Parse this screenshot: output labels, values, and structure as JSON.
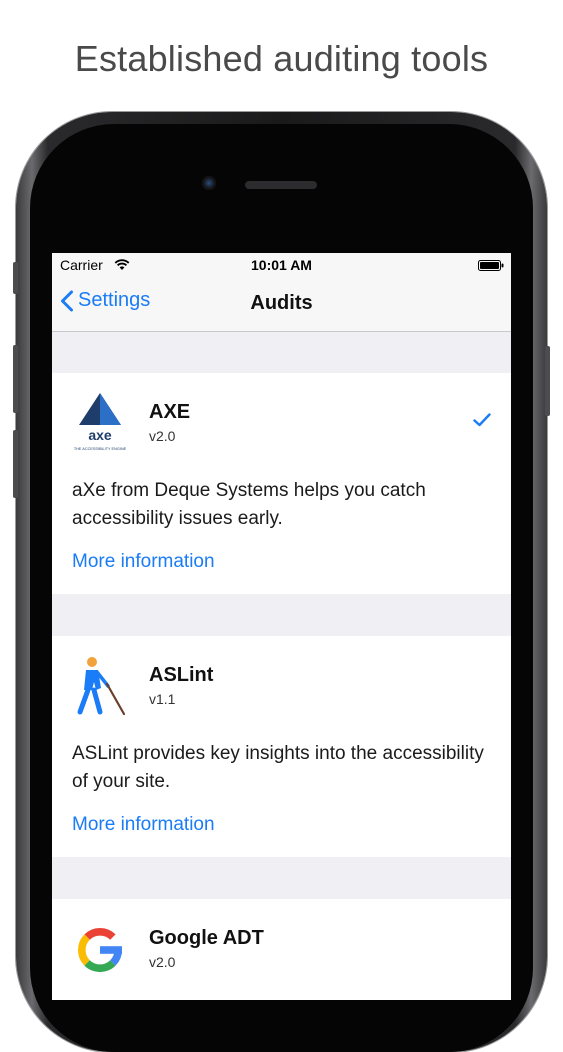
{
  "headline": "Established auditing tools",
  "status_bar": {
    "carrier": "Carrier",
    "time": "10:01 AM",
    "icons": [
      "wifi-icon",
      "battery-icon"
    ]
  },
  "nav": {
    "back_label": "Settings",
    "title": "Audits",
    "back_icon": "chevron-left-icon"
  },
  "audits": [
    {
      "name": "AXE",
      "version": "v2.0",
      "logo_text": "axe",
      "logo_tagline": "THE ACCESSIBILITY ENGINE",
      "selected": true,
      "description": "aXe from Deque Systems helps you catch accessibility issues early.",
      "link": "More information"
    },
    {
      "name": "ASLint",
      "version": "v1.1",
      "selected": false,
      "description": "ASLint provides key insights into the accessibility of your site.",
      "link": "More information"
    },
    {
      "name": "Google ADT",
      "version": "v2.0",
      "selected": false
    }
  ],
  "colors": {
    "accent": "#1a7cf6",
    "grouped_background": "#efeff4",
    "axe_navy": "#1f3d6b",
    "axe_blue": "#2b6fc7"
  }
}
